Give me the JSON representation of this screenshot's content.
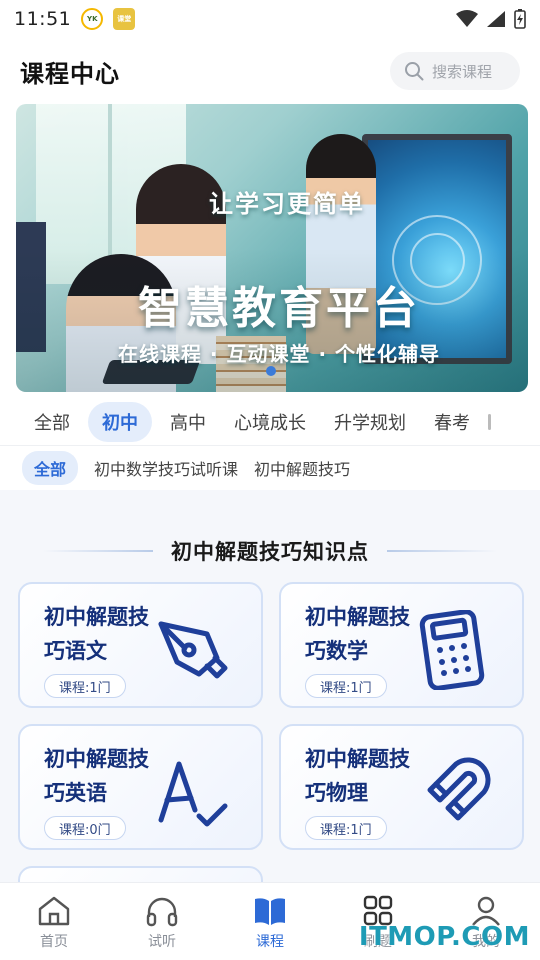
{
  "status_bar": {
    "time": "11:51",
    "app_icon_1": "YK",
    "app_icon_2": "课堂"
  },
  "header": {
    "title": "课程中心",
    "search_placeholder": "搜索课程"
  },
  "banner": {
    "slogan": "让学习更简单",
    "title": "智慧教育平台",
    "subtitle": "在线课程 · 互动课堂 · 个性化辅导"
  },
  "tabs": [
    {
      "label": "全部",
      "active": false
    },
    {
      "label": "初中",
      "active": true
    },
    {
      "label": "高中",
      "active": false
    },
    {
      "label": "心境成长",
      "active": false
    },
    {
      "label": "升学规划",
      "active": false
    },
    {
      "label": "春考",
      "active": false
    }
  ],
  "subtabs": [
    {
      "label": "全部",
      "active": true
    },
    {
      "label": "初中数学技巧试听课",
      "active": false
    },
    {
      "label": "初中解题技巧",
      "active": false
    }
  ],
  "section": {
    "title": "初中解题技巧知识点"
  },
  "cards": [
    {
      "title": "初中解题技巧语文",
      "count": "课程:1门",
      "icon": "pen-nib-icon"
    },
    {
      "title": "初中解题技巧数学",
      "count": "课程:1门",
      "icon": "calculator-icon"
    },
    {
      "title": "初中解题技巧英语",
      "count": "课程:0门",
      "icon": "letter-a-check-icon"
    },
    {
      "title": "初中解题技巧物理",
      "count": "课程:1门",
      "icon": "magnet-icon"
    }
  ],
  "bottom_nav": [
    {
      "label": "首页",
      "icon": "home-icon",
      "active": false
    },
    {
      "label": "试听",
      "icon": "headphones-icon",
      "active": false
    },
    {
      "label": "课程",
      "icon": "book-icon",
      "active": true
    },
    {
      "label": "刷题",
      "icon": "grid-icon",
      "active": false
    },
    {
      "label": "我的",
      "icon": "user-icon",
      "active": false
    }
  ],
  "watermark": "ITMOP.COM",
  "colors": {
    "accent": "#2d6ad6",
    "card_text": "#15307a",
    "tab_active_bg": "#e4edfb",
    "icon_stroke": "#1f3f9a"
  }
}
